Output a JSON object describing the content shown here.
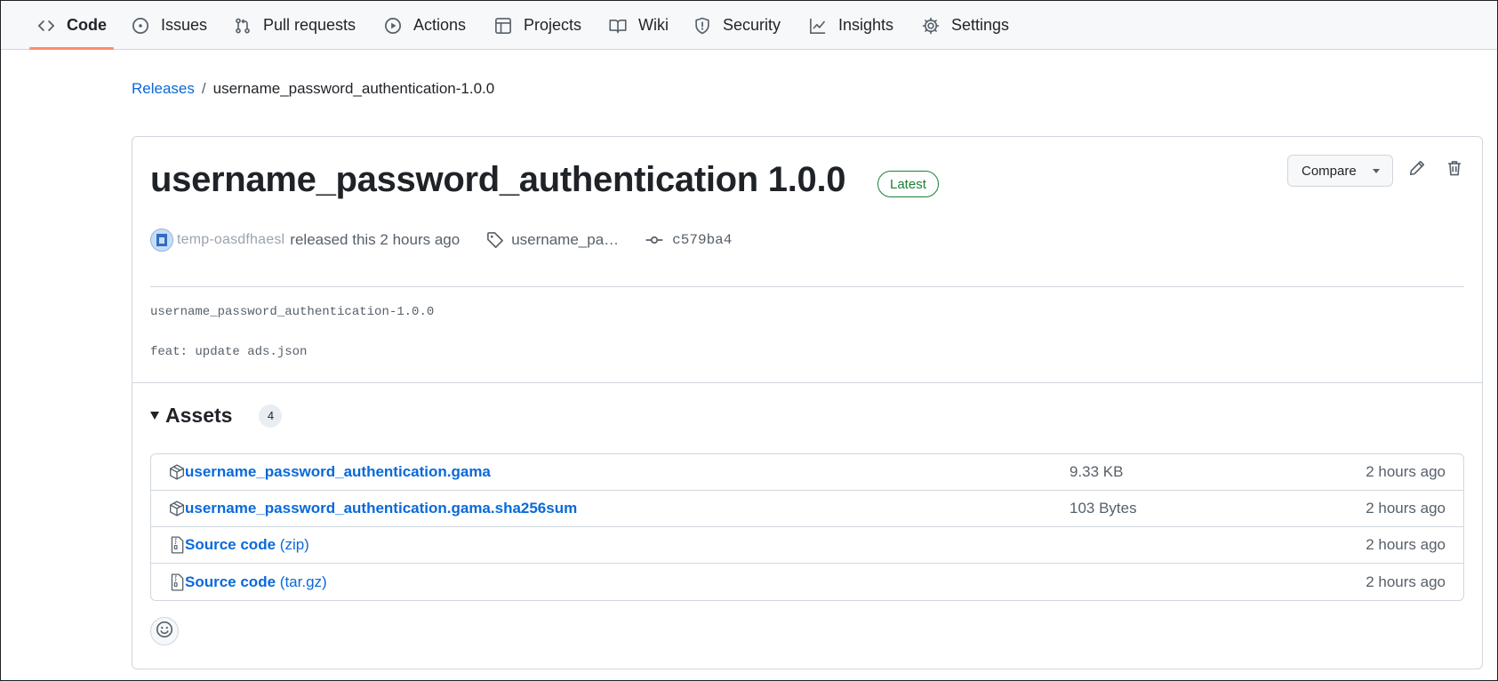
{
  "nav": {
    "items": [
      {
        "label": "Code",
        "icon": "code-icon",
        "active": true
      },
      {
        "label": "Issues",
        "icon": "issue-icon"
      },
      {
        "label": "Pull requests",
        "icon": "pull-request-icon"
      },
      {
        "label": "Actions",
        "icon": "play-icon"
      },
      {
        "label": "Projects",
        "icon": "table-icon"
      },
      {
        "label": "Wiki",
        "icon": "book-icon"
      },
      {
        "label": "Security",
        "icon": "shield-icon"
      },
      {
        "label": "Insights",
        "icon": "graph-icon"
      },
      {
        "label": "Settings",
        "icon": "gear-icon"
      }
    ],
    "active_color": "#fd8c73"
  },
  "breadcrumb": {
    "root": "Releases",
    "separator": "/",
    "current": "username_password_authentication-1.0.0"
  },
  "release": {
    "title": "username_password_authentication 1.0.0",
    "badge": "Latest",
    "compare_label": "Compare",
    "author": "temp-oasdfhaesl",
    "released_text": "released this 2 hours ago",
    "tag": "username_pa…",
    "commit": "c579ba4",
    "notes": [
      "username_password_authentication-1.0.0",
      "feat: update ads.json"
    ]
  },
  "assets": {
    "heading": "Assets",
    "count": "4",
    "rows": [
      {
        "name": "username_password_authentication.gama",
        "format": "",
        "size": "9.33 KB",
        "time": "2 hours ago",
        "icon": "package-icon"
      },
      {
        "name": "username_password_authentication.gama.sha256sum",
        "format": "",
        "size": "103 Bytes",
        "time": "2 hours ago",
        "icon": "package-icon"
      },
      {
        "name": "Source code",
        "format": "(zip)",
        "size": "",
        "time": "2 hours ago",
        "icon": "file-zip-icon"
      },
      {
        "name": "Source code",
        "format": "(tar.gz)",
        "size": "",
        "time": "2 hours ago",
        "icon": "file-zip-icon"
      }
    ]
  },
  "colors": {
    "link": "#0969da",
    "latest_green": "#1a7f37",
    "muted": "#57606a"
  }
}
